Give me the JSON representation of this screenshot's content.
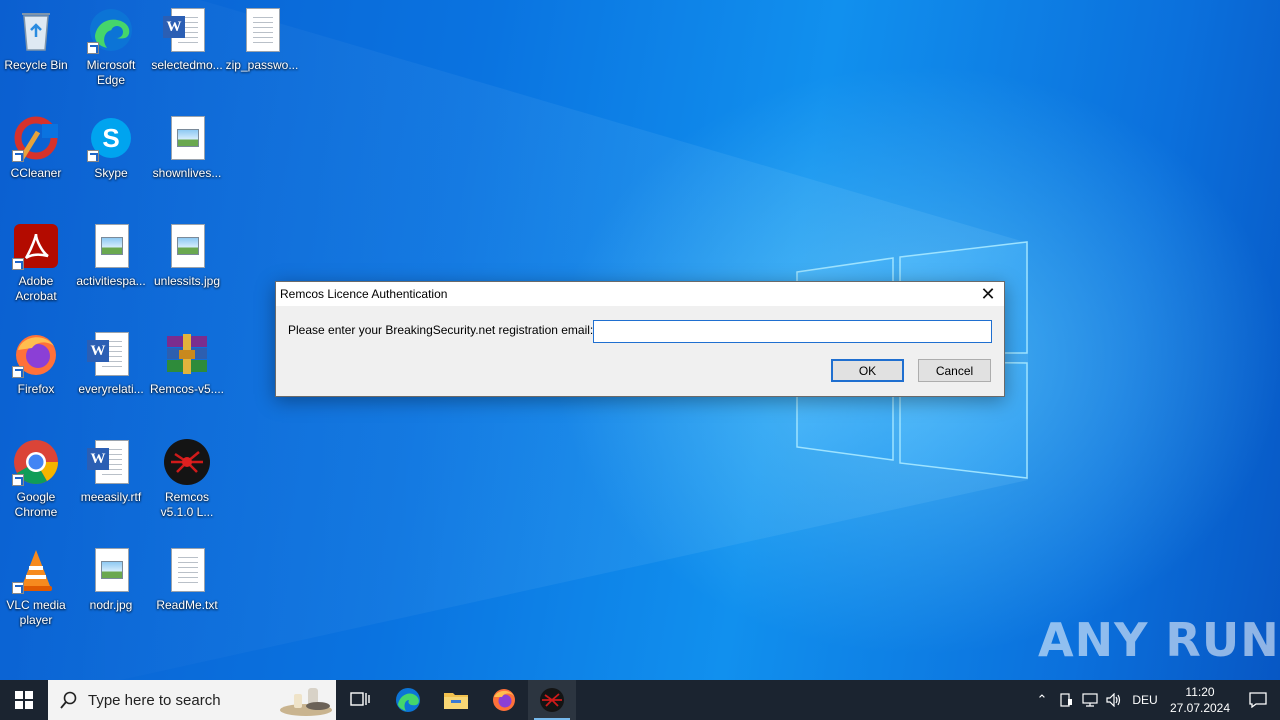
{
  "desktop": {
    "icons": [
      {
        "label": "Recycle Bin",
        "icon": "recycle-bin-icon"
      },
      {
        "label": "Microsoft Edge",
        "icon": "edge-icon"
      },
      {
        "label": "selectedmo...",
        "icon": "word-document-icon"
      },
      {
        "label": "zip_passwo...",
        "icon": "text-file-icon"
      },
      {
        "label": "CCleaner",
        "icon": "ccleaner-icon"
      },
      {
        "label": "Skype",
        "icon": "skype-icon"
      },
      {
        "label": "shownlives...",
        "icon": "image-file-icon"
      },
      {
        "label": "Adobe Acrobat",
        "icon": "adobe-acrobat-icon"
      },
      {
        "label": "activitiespa...",
        "icon": "image-file-icon"
      },
      {
        "label": "unlessits.jpg",
        "icon": "image-file-icon"
      },
      {
        "label": "Firefox",
        "icon": "firefox-icon"
      },
      {
        "label": "everyrelati...",
        "icon": "word-document-icon"
      },
      {
        "label": "Remcos-v5....",
        "icon": "winrar-archive-icon"
      },
      {
        "label": "Google Chrome",
        "icon": "chrome-icon"
      },
      {
        "label": "meeasily.rtf",
        "icon": "word-document-icon"
      },
      {
        "label": "Remcos v5.1.0 L...",
        "icon": "remcos-icon"
      },
      {
        "label": "VLC media player",
        "icon": "vlc-icon"
      },
      {
        "label": "nodr.jpg",
        "icon": "image-file-icon"
      },
      {
        "label": "ReadMe.txt",
        "icon": "text-file-icon"
      }
    ]
  },
  "dialog": {
    "title": "Remcos Licence Authentication",
    "prompt": "Please enter your BreakingSecurity.net registration email:",
    "email_value": "",
    "ok_label": "OK",
    "cancel_label": "Cancel"
  },
  "watermark": {
    "text": "ANY RUN"
  },
  "taskbar": {
    "search_placeholder": "Type here to search",
    "apps": [
      "task-view-icon",
      "edge-icon",
      "file-explorer-icon",
      "firefox-icon",
      "remcos-icon"
    ],
    "tray": {
      "language": "DEU",
      "time": "11:20",
      "date": "27.07.2024"
    }
  },
  "colors": {
    "accent": "#1f6fd0",
    "taskbar": "#1b2430",
    "wallpaper": "#0a73e0"
  }
}
